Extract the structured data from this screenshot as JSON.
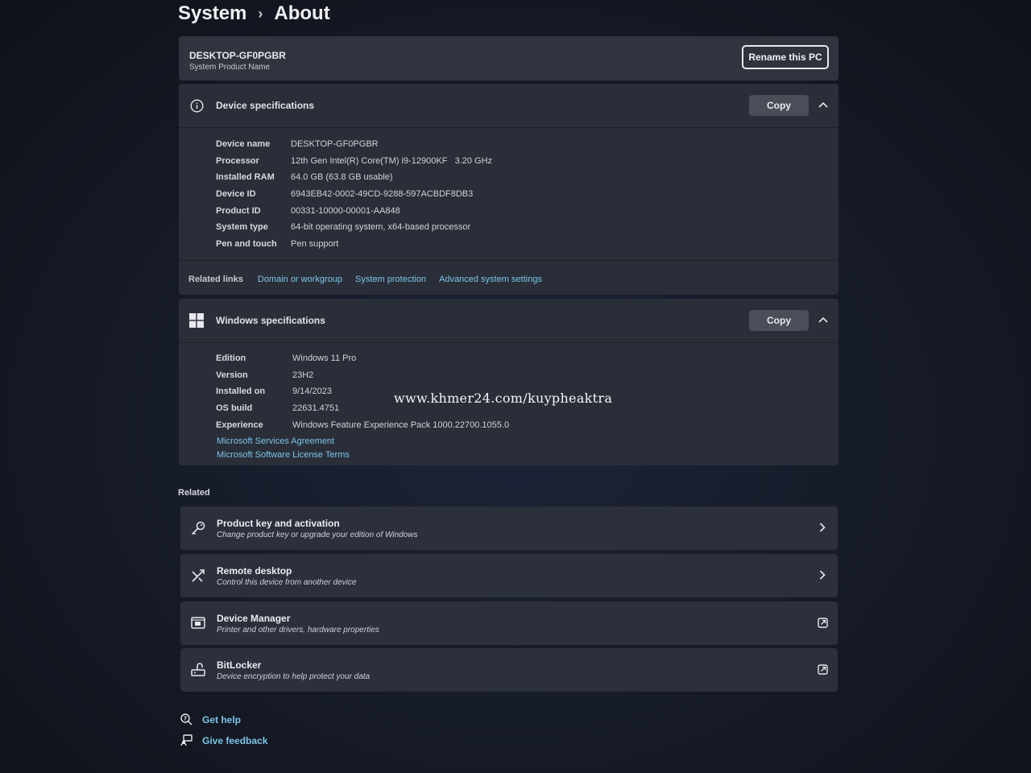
{
  "breadcrumb": {
    "parent": "System",
    "separator": "›",
    "current": "About"
  },
  "device": {
    "name": "DESKTOP-GF0PGBR",
    "subtitle": "System Product Name",
    "rename_label": "Rename this PC"
  },
  "device_specs": {
    "title": "Device specifications",
    "copy_label": "Copy",
    "rows": [
      {
        "key": "Device name",
        "value": "DESKTOP-GF0PGBR"
      },
      {
        "key": "Processor",
        "value": "12th Gen Intel(R) Core(TM) i9-12900KF   3.20 GHz"
      },
      {
        "key": "Installed RAM",
        "value": "64.0 GB (63.8 GB usable)"
      },
      {
        "key": "Device ID",
        "value": "6943EB42-0002-49CD-9288-597ACBDF8DB3"
      },
      {
        "key": "Product ID",
        "value": "00331-10000-00001-AA848"
      },
      {
        "key": "System type",
        "value": "64-bit operating system, x64-based processor"
      },
      {
        "key": "Pen and touch",
        "value": "Pen support"
      }
    ]
  },
  "related_links": {
    "label": "Related links",
    "links": [
      "Domain or workgroup",
      "System protection",
      "Advanced system settings"
    ]
  },
  "windows_specs": {
    "title": "Windows specifications",
    "copy_label": "Copy",
    "rows": [
      {
        "key": "Edition",
        "value": "Windows 11 Pro"
      },
      {
        "key": "Version",
        "value": "23H2"
      },
      {
        "key": "Installed on",
        "value": "9/14/2023"
      },
      {
        "key": "OS build",
        "value": "22631.4751"
      },
      {
        "key": "Experience",
        "value": "Windows Feature Experience Pack 1000.22700.1055.0"
      }
    ],
    "links": [
      "Microsoft Services Agreement",
      "Microsoft Software License Terms"
    ]
  },
  "watermark": "www.khmer24.com/kuypheaktra",
  "related": {
    "title": "Related",
    "items": [
      {
        "title": "Product key and activation",
        "subtitle": "Change product key or upgrade your edition of Windows",
        "icon": "key-icon",
        "end_icon": "chevron-right-icon"
      },
      {
        "title": "Remote desktop",
        "subtitle": "Control this device from another device",
        "icon": "remote-desktop-icon",
        "end_icon": "chevron-right-icon"
      },
      {
        "title": "Device Manager",
        "subtitle": "Printer and other drivers, hardware properties",
        "icon": "device-manager-icon",
        "end_icon": "external-link-icon"
      },
      {
        "title": "BitLocker",
        "subtitle": "Device encryption to help protect your data",
        "icon": "bitlocker-icon",
        "end_icon": "external-link-icon"
      }
    ]
  },
  "footer": {
    "get_help": "Get help",
    "give_feedback": "Give feedback"
  },
  "colors": {
    "link": "#7cc6e8",
    "card": "#2a2e39",
    "background": "#151a26"
  }
}
